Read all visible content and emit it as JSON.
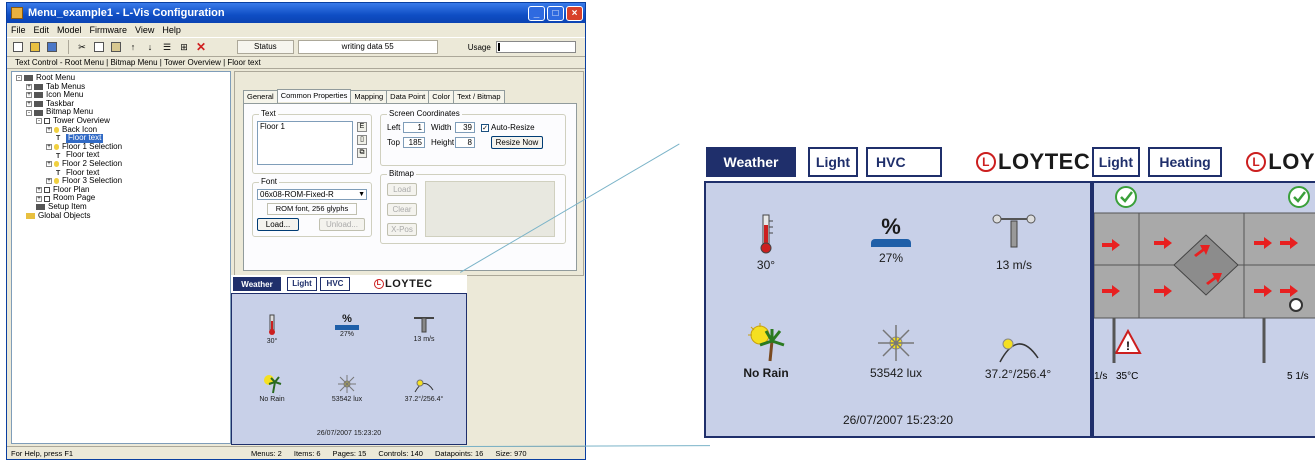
{
  "window": {
    "title": "Menu_example1 - L-Vis Configuration",
    "menu": [
      "File",
      "Edit",
      "Model",
      "Firmware",
      "View",
      "Help"
    ],
    "status_label": "Status",
    "status_value": "writing data 55",
    "usage_label": "Usage",
    "usage_fraction": 0.03,
    "breadcrumb": "Text Control - Root Menu | Bitmap Menu | Tower Overview | Floor text"
  },
  "tree": [
    {
      "label": "Root Menu",
      "indent": 0,
      "exp": "-",
      "icon": "menu"
    },
    {
      "label": "Tab Menus",
      "indent": 1,
      "exp": "+",
      "icon": "menu"
    },
    {
      "label": "Icon Menu",
      "indent": 1,
      "exp": "+",
      "icon": "menu"
    },
    {
      "label": "Taskbar",
      "indent": 1,
      "exp": "+",
      "icon": "menu"
    },
    {
      "label": "Bitmap Menu",
      "indent": 1,
      "exp": "-",
      "icon": "menu"
    },
    {
      "label": "Tower Overview",
      "indent": 2,
      "exp": "-",
      "icon": "page"
    },
    {
      "label": "Back Icon",
      "indent": 3,
      "exp": "+",
      "icon": "bulb"
    },
    {
      "label": "Floor text",
      "indent": 3,
      "exp": "",
      "icon": "text",
      "selected": true
    },
    {
      "label": "Floor 1 Selection",
      "indent": 3,
      "exp": "+",
      "icon": "bulb"
    },
    {
      "label": "Floor text",
      "indent": 3,
      "exp": "",
      "icon": "text"
    },
    {
      "label": "Floor 2 Selection",
      "indent": 3,
      "exp": "+",
      "icon": "bulb"
    },
    {
      "label": "Floor text",
      "indent": 3,
      "exp": "",
      "icon": "text"
    },
    {
      "label": "Floor 3 Selection",
      "indent": 3,
      "exp": "+",
      "icon": "bulb"
    },
    {
      "label": "Floor Plan",
      "indent": 2,
      "exp": "+",
      "icon": "page"
    },
    {
      "label": "Room Page",
      "indent": 2,
      "exp": "+",
      "icon": "page"
    },
    {
      "label": "Setup Item",
      "indent": 1,
      "exp": "",
      "icon": "menu"
    },
    {
      "label": "Global Objects",
      "indent": 0,
      "exp": "",
      "icon": "folder"
    }
  ],
  "props": {
    "tabs": [
      "General",
      "Common Properties",
      "Mapping",
      "Data Point",
      "Color",
      "Text / Bitmap"
    ],
    "active_tab": 1,
    "text_group": "Text",
    "text_value": "Floor 1",
    "font_group": "Font",
    "font_value": "06x08-ROM-Fixed-R",
    "font_info": "ROM font, 256 glyphs",
    "load": "Load...",
    "unload": "Unload...",
    "coords_group": "Screen Coordinates",
    "left_label": "Left",
    "left_value": "1",
    "width_label": "Width",
    "width_value": "39",
    "top_label": "Top",
    "top_value": "185",
    "height_label": "Height",
    "height_value": "8",
    "autoresize": "Auto-Resize",
    "resize_now": "Resize Now",
    "bitmap_group": "Bitmap",
    "bitmap_load": "Load",
    "bitmap_clear": "Clear",
    "bitmap_x": "X-Pos"
  },
  "statusbar": {
    "help": "For Help, press F1",
    "menus": "Menus: 2",
    "items": "Items: 6",
    "pages": "Pages: 15",
    "controls": "Controls: 140",
    "datapoints": "Datapoints: 16",
    "size": "Size: 970"
  },
  "weather": {
    "tabs": [
      "Weather",
      "Light",
      "HVC"
    ],
    "logo": "LOYTEC",
    "temperature": "30°",
    "humidity": "27%",
    "wind": "13 m/s",
    "rain": "No Rain",
    "light": "53542 lux",
    "sun": "37.2°/256.4°",
    "datetime": "26/07/2007 15:23:20",
    "humidity_symbol": "%"
  },
  "hvac": {
    "tabs": [
      "Light",
      "Heating"
    ],
    "logo": "LOY",
    "temp": "35°C",
    "flow1": "1/s",
    "flow2": "5 1/s"
  },
  "colors": {
    "navy": "#1f2f6b",
    "panel_bg": "#c8d0e8",
    "accent_red": "#cc1f1f",
    "xp_blue": "#0f4ec4"
  }
}
